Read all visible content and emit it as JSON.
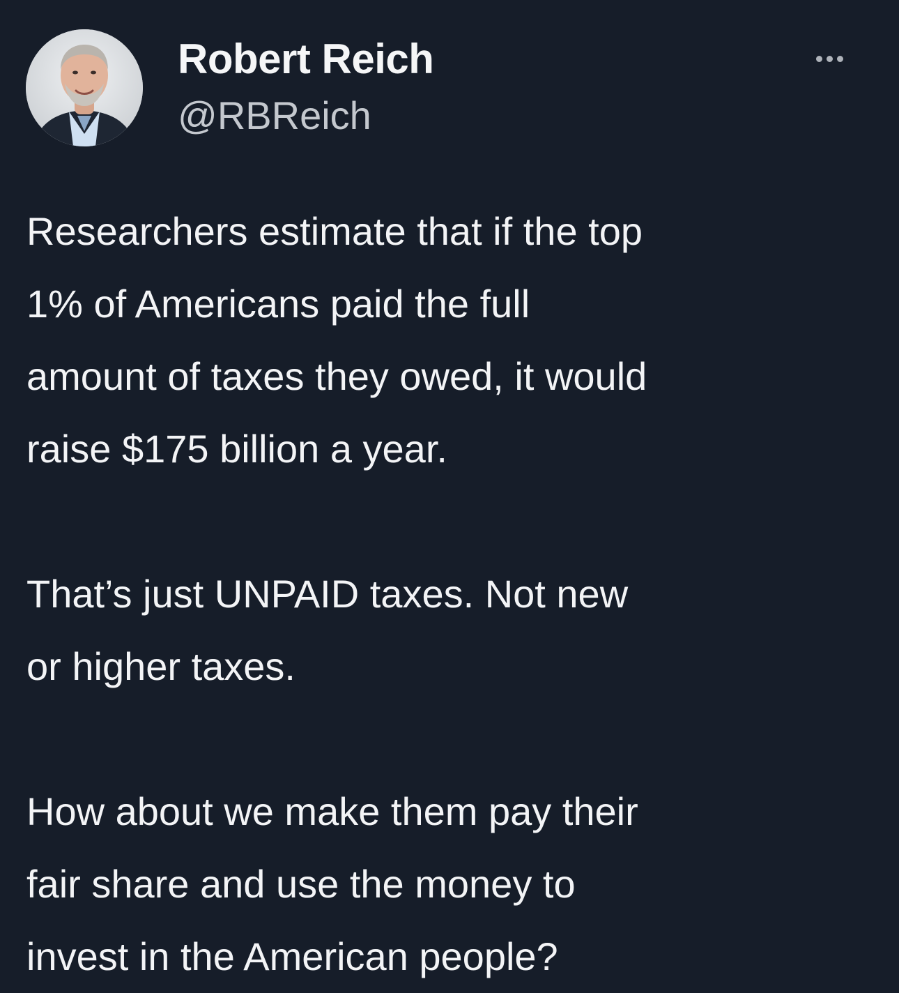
{
  "author": {
    "name": "Robert Reich",
    "handle": "@RBReich"
  },
  "more_icon": "more-horizontal-icon",
  "tweet": {
    "paragraphs": [
      {
        "lines": [
          "Researchers estimate that if the top",
          "1% of Americans paid the full",
          "amount of taxes they owed, it would",
          "raise $175 billion a year."
        ]
      },
      {
        "lines": [
          "That’s just UNPAID taxes. Not new",
          "or higher taxes."
        ]
      },
      {
        "lines": [
          "How about we make them pay their",
          "fair share and use the money to",
          "invest in the American people?"
        ]
      }
    ]
  },
  "colors": {
    "background": "#161d29",
    "text": "#f3f4f6",
    "handle": "#c4c8ce"
  }
}
